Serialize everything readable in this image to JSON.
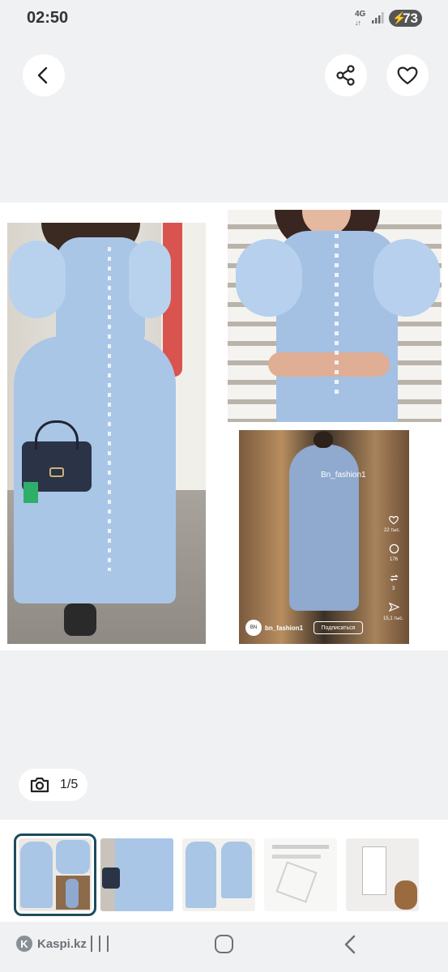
{
  "status_bar": {
    "time": "02:50",
    "network": "4G",
    "battery": "73"
  },
  "top_bar": {
    "back_icon": "chevron-left-icon",
    "share_icon": "share-icon",
    "favorite_icon": "heart-icon"
  },
  "gallery": {
    "overlay_texts": {
      "watermark": "Bn_fashion1",
      "likes": "22 тыс.",
      "comments": "176",
      "reposts": "3",
      "shares": "15,1 тыс.",
      "account": "bn_fashion1",
      "subscribe": "Подписаться",
      "avatar_text": "BN"
    }
  },
  "photo_counter": {
    "icon": "camera-icon",
    "text": "1/5"
  },
  "thumbnails": {
    "count": 5,
    "active_index": 0
  },
  "nav_bar": {
    "brand": "Kaspi.kz",
    "brand_logo": "K"
  },
  "colors": {
    "background": "#f0f1f3",
    "dress": "#a9c6e6",
    "active_thumb_border": "#1d4b5c"
  }
}
